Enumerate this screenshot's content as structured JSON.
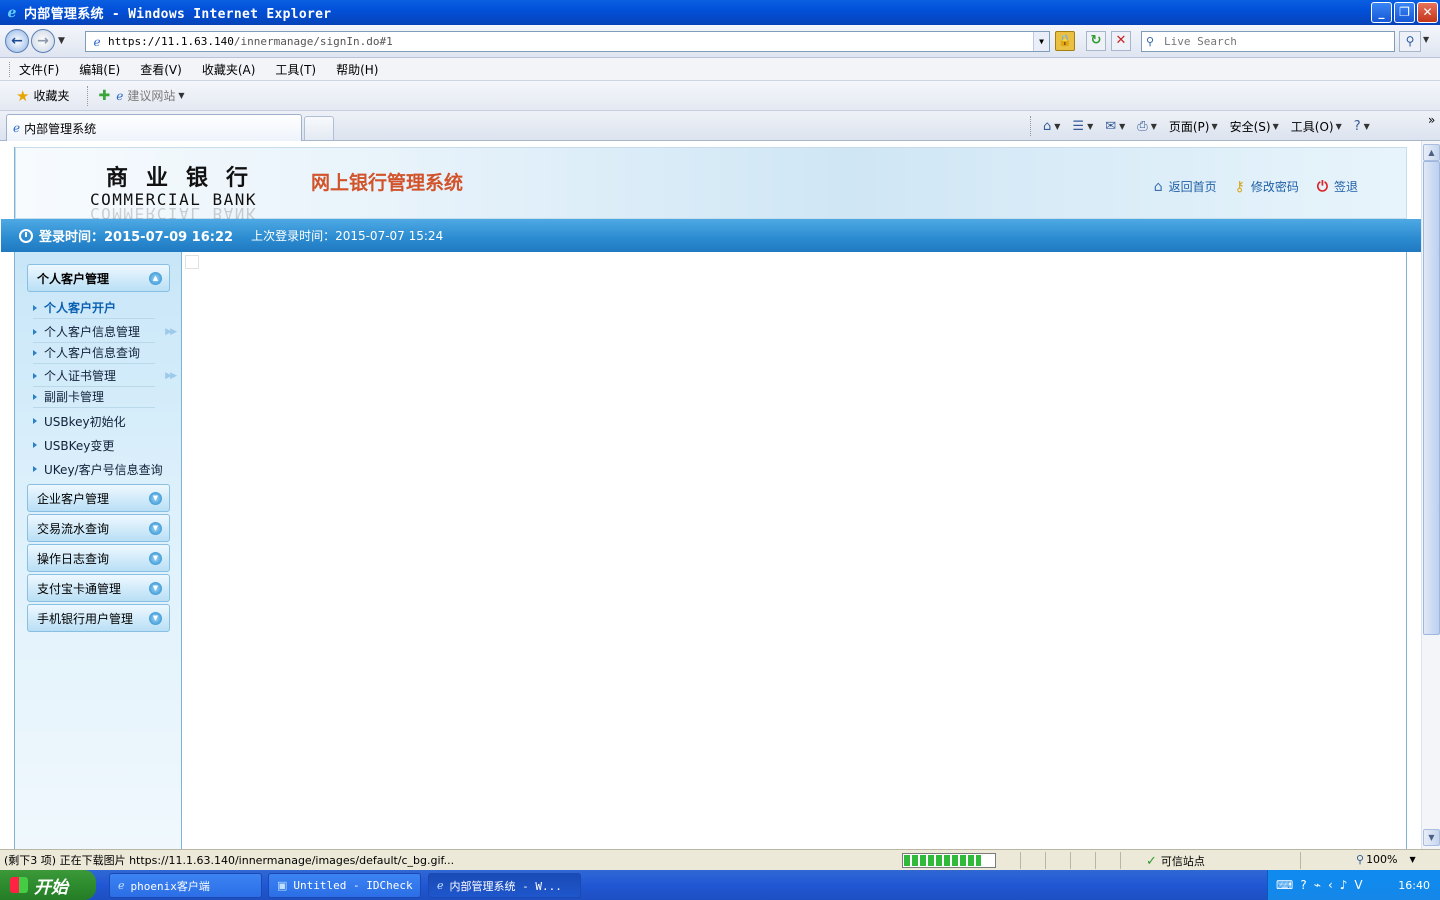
{
  "window": {
    "title": "内部管理系统 - Windows Internet Explorer",
    "buttons": {
      "minimize": "_",
      "restore": "❐",
      "close": "✕"
    }
  },
  "address": {
    "url_host": "https://11.1.63.140",
    "url_path": "/innermanage/signIn.do#1",
    "search_placeholder": "Live Search"
  },
  "menu": {
    "items": [
      "文件(F)",
      "编辑(E)",
      "查看(V)",
      "收藏夹(A)",
      "工具(T)",
      "帮助(H)"
    ]
  },
  "favorites": {
    "label": "收藏夹",
    "suggested": "建议网站"
  },
  "tabs": {
    "active_label": "内部管理系统"
  },
  "commandbar": {
    "page": "页面(P)",
    "safety": "安全(S)",
    "tools": "工具(O)",
    "help_icon": "?"
  },
  "header": {
    "logo_cn": "商业银行",
    "logo_en": "COMMERCIAL BANK",
    "system_title": "网上银行管理系统",
    "links": {
      "home": "返回首页",
      "change_password": "修改密码",
      "logout": "签退"
    }
  },
  "infobar": {
    "login_time": "登录时间：2015-07-09 16:22",
    "last_login": "上次登录时间：2015-07-07 15:24"
  },
  "sidebar": {
    "groups": [
      {
        "label": "个人客户管理",
        "expanded": true
      },
      {
        "label": "企业客户管理"
      },
      {
        "label": "交易流水查询"
      },
      {
        "label": "操作日志查询"
      },
      {
        "label": "支付宝卡通管理"
      },
      {
        "label": "手机银行用户管理"
      }
    ],
    "subitems": [
      {
        "label": "个人客户开户",
        "active": true
      },
      {
        "label": "个人客户信息管理",
        "has_more": true
      },
      {
        "label": "个人客户信息查询"
      },
      {
        "label": "个人证书管理",
        "has_more": true
      },
      {
        "label": "副副卡管理"
      },
      {
        "label": "USBkey初始化"
      },
      {
        "label": "USBKey变更"
      },
      {
        "label": "UKey/客户号信息查询"
      }
    ]
  },
  "statusbar": {
    "text": "(剩下3 项) 正在下载图片 https://11.1.63.140/innermanage/images/default/c_bg.gif...",
    "progress": 0.85,
    "zone": "可信站点",
    "zoom": "100%"
  },
  "taskbar": {
    "start": "开始",
    "tasks": [
      "phoenix客户端",
      "Untitled - IDCheck",
      "内部管理系统 - W..."
    ],
    "clock": "16:40"
  },
  "colors": {
    "accent": "#2b8bd0",
    "title_red": "#d2532a",
    "link_blue": "#1f5fa6"
  }
}
